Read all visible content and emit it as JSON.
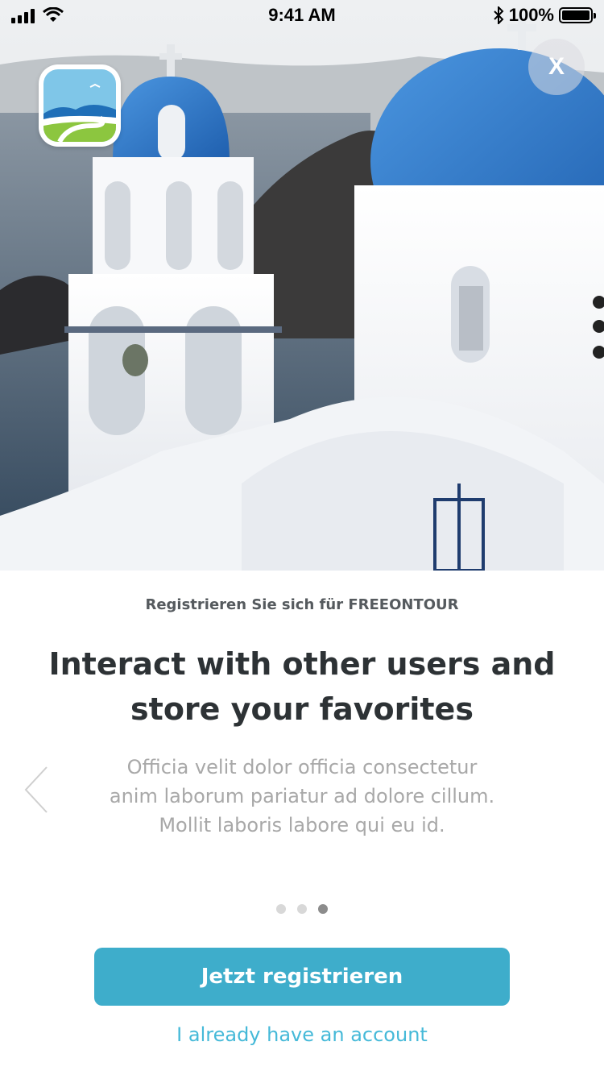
{
  "status_bar": {
    "time": "9:41 AM",
    "battery_text": "100%",
    "battery_level": 1.0
  },
  "hero": {
    "icons": {
      "close": "close-icon",
      "logo": "freeontour-logo"
    },
    "close_label": "X"
  },
  "content": {
    "subtitle": "Registrieren Sie sich für FREEONTOUR",
    "headline": "Interact with other users and store your favorites",
    "body": "Officia velit dolor officia consectetur anim laborum pariatur ad dolore cillum. Mollit laboris labore qui eu id.",
    "pagination": {
      "total": 3,
      "active_index": 2
    },
    "register_button": "Jetzt registrieren",
    "login_link": "I already have an account"
  },
  "colors": {
    "accent": "#3eadcb",
    "link": "#45b9d8",
    "dome_blue": "#2f78c7"
  }
}
